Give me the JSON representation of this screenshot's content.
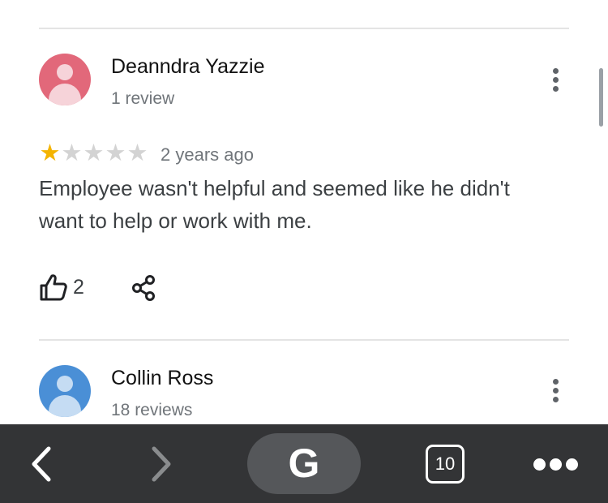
{
  "reviews": [
    {
      "name": "Deanndra Yazzie",
      "review_count": "1 review",
      "avatar_color": "#e2687a",
      "avatar_light": "#f6d3d9",
      "rating": 1,
      "max_rating": 5,
      "time": "2 years ago",
      "text": "Employee wasn't helpful and seemed like he didn't want to help or work with me.",
      "likes": "2"
    },
    {
      "name": "Collin Ross",
      "review_count": "18 reviews",
      "avatar_color": "#4a8fd6",
      "avatar_light": "#c5dcf3"
    }
  ],
  "colors": {
    "star_filled": "#f4b400",
    "star_empty": "#d3d3d3",
    "toolbar_bg": "#333436"
  },
  "icons": {
    "like": "thumbs-up-icon",
    "share": "share-icon",
    "more": "more-vertical-icon",
    "back": "chevron-left-icon",
    "forward": "chevron-right-icon",
    "google": "google-g-icon",
    "tabs": "tabs-icon",
    "menu": "more-horizontal-icon"
  },
  "toolbar": {
    "google_label": "G",
    "tabs_count": "10"
  }
}
